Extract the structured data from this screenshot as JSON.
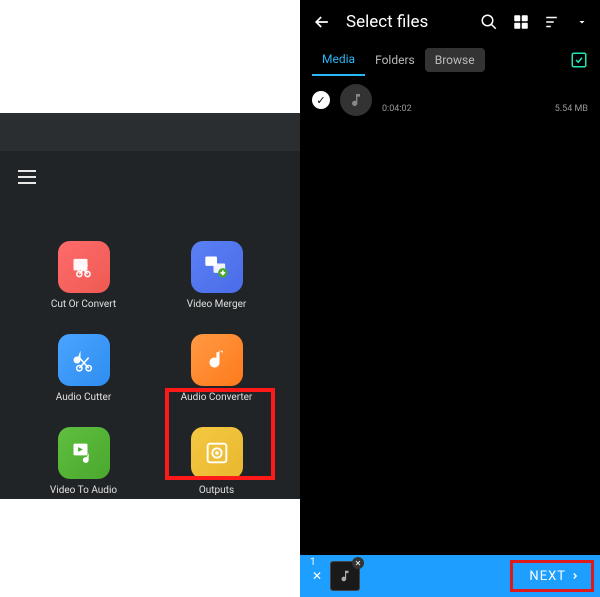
{
  "left": {
    "apps": [
      {
        "label": "Cut Or Convert",
        "name": "cut-or-convert"
      },
      {
        "label": "Video Merger",
        "name": "video-merger"
      },
      {
        "label": "Audio Cutter",
        "name": "audio-cutter"
      },
      {
        "label": "Audio Converter",
        "name": "audio-converter"
      },
      {
        "label": "Video To Audio",
        "name": "video-to-audio"
      },
      {
        "label": "Outputs",
        "name": "outputs"
      }
    ]
  },
  "right": {
    "title": "Select files",
    "tabs": [
      {
        "label": "Media",
        "active": true
      },
      {
        "label": "Folders",
        "active": false
      },
      {
        "label": "Browse",
        "active": false
      }
    ],
    "file": {
      "duration": "0:04:02",
      "size": "5.54 MB"
    },
    "selected_count": "1",
    "next_label": "NEXT"
  }
}
